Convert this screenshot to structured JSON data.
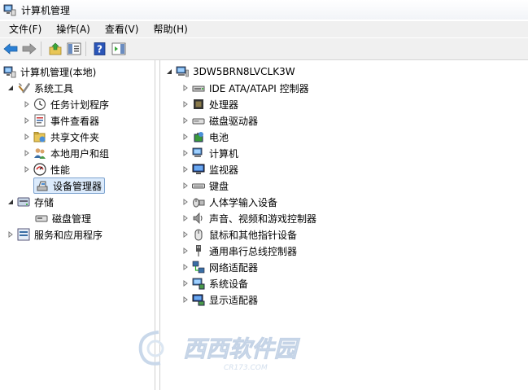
{
  "window": {
    "title": "计算机管理"
  },
  "menu": [
    "文件(F)",
    "操作(A)",
    "查看(V)",
    "帮助(H)"
  ],
  "left_tree": {
    "root": "计算机管理(本地)",
    "system_tools": "系统工具",
    "system_children": [
      "任务计划程序",
      "事件查看器",
      "共享文件夹",
      "本地用户和组",
      "性能",
      "设备管理器"
    ],
    "storage": "存储",
    "storage_children": [
      "磁盘管理"
    ],
    "services": "服务和应用程序"
  },
  "device_tree": {
    "computer": "3DW5BRN8LVCLK3W",
    "categories": [
      "IDE ATA/ATAPI 控制器",
      "处理器",
      "磁盘驱动器",
      "电池",
      "计算机",
      "监视器",
      "键盘",
      "人体学输入设备",
      "声音、视频和游戏控制器",
      "鼠标和其他指针设备",
      "通用串行总线控制器",
      "网络适配器",
      "系统设备",
      "显示适配器"
    ]
  },
  "watermark": {
    "brand": "西西软件园",
    "domain": "CR173.COM"
  }
}
